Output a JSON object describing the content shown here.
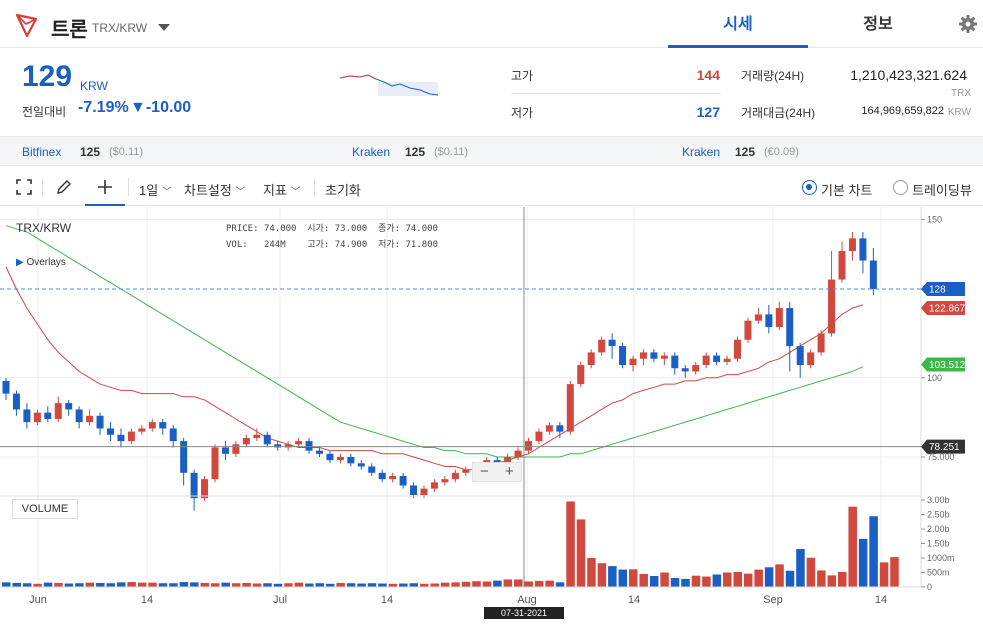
{
  "header": {
    "coin_name": "트론",
    "pair": "TRX/KRW",
    "tabs": [
      "시세",
      "정보"
    ]
  },
  "summary": {
    "price": "129",
    "unit": "KRW",
    "change_label": "전일대비",
    "change_pct": "-7.19%",
    "change_abs": "▼-10.00",
    "high_label": "고가",
    "high": "144",
    "low_label": "저가",
    "low": "127",
    "volume_label": "거래량(24H)",
    "volume": "1,210,423,321.624",
    "volume_unit": "TRX",
    "amount_label": "거래대금(24H)",
    "amount": "164,969,659,822",
    "amount_unit": "KRW"
  },
  "exchanges": [
    {
      "name": "Bitfinex",
      "price": "125",
      "ref": "($0.11)"
    },
    {
      "name": "Kraken",
      "price": "125",
      "ref": "($0.11)"
    },
    {
      "name": "Kraken",
      "price": "125",
      "ref": "(€0.09)"
    }
  ],
  "toolbar": {
    "interval": "1일",
    "chart_settings": "차트설정",
    "indicators": "지표",
    "reset": "초기화",
    "basic_chart": "기본 차트",
    "tradingview": "트레이딩뷰"
  },
  "colors": {
    "up": "#d1483f",
    "down": "#1a5fc4",
    "ma_short": "#d1483f",
    "ma_long": "#3db74a",
    "accent": "#1a5fc4"
  },
  "chart_data": {
    "type": "candlestick",
    "symbol": "TRX/KRW",
    "overlays_label": "Overlays",
    "ohlc_legend": {
      "price_label": "PRICE:",
      "price": "74.000",
      "open_label": "시가:",
      "open": "73.000",
      "close_label": "종가:",
      "close": "74.000",
      "vol_label": "VOL:",
      "vol": "244M",
      "high_label": "고가:",
      "high": "74.900",
      "low_label": "저가:",
      "low": "71.800"
    },
    "x_ticks": [
      "Jun",
      "14",
      "Jul",
      "14",
      "Aug",
      "14",
      "Sep",
      "14"
    ],
    "y_ticks": [
      "150",
      "100",
      "75.000"
    ],
    "vol_ticks": [
      "3.00b",
      "2.50b",
      "2.00b",
      "1.50b",
      "1000m",
      "500m",
      "0"
    ],
    "ylim": [
      63,
      152
    ],
    "vol_max": 3000,
    "price_badges": {
      "current": "128",
      "ma_short": "122.867",
      "ma_long": "103.512",
      "crosshair": "78.251"
    },
    "crosshair_date": "07-31-2021",
    "volume_label": "VOLUME",
    "ma_short_values": [
      135,
      128,
      122,
      117,
      112,
      108,
      105,
      102,
      100,
      98,
      97,
      96,
      96,
      95,
      95,
      95,
      95,
      94,
      94,
      93,
      91,
      89,
      87,
      85,
      83,
      81,
      80,
      79,
      78,
      78,
      78,
      77,
      77,
      77,
      77,
      77,
      76,
      76,
      76,
      75,
      74,
      73,
      72,
      72,
      71,
      71,
      72,
      73,
      74,
      75,
      76,
      78,
      80,
      82,
      84,
      86,
      88,
      90,
      92,
      93,
      95,
      96,
      97,
      98,
      98,
      99,
      99,
      100,
      100,
      101,
      101,
      102,
      103,
      105,
      106,
      108,
      110,
      112,
      114,
      117,
      120,
      122,
      123
    ],
    "ma_long_values": [
      148,
      147,
      146,
      144,
      142,
      140,
      138,
      136,
      134,
      132,
      130,
      128,
      126,
      124,
      122,
      120,
      118,
      116,
      114,
      112,
      110,
      108,
      106,
      104,
      102,
      100,
      98,
      96,
      94,
      92,
      90,
      88,
      86,
      85,
      84,
      83,
      82,
      81,
      80,
      79,
      78,
      78,
      77,
      77,
      76,
      76,
      76,
      75,
      75,
      75,
      75,
      75,
      75,
      75,
      76,
      76,
      77,
      78,
      79,
      80,
      81,
      82,
      83,
      84,
      85,
      86,
      87,
      88,
      89,
      90,
      91,
      92,
      93,
      94,
      95,
      96,
      97,
      98,
      99,
      100,
      101,
      102,
      103.5
    ],
    "candles": [
      [
        99,
        95,
        100,
        93
      ],
      [
        95,
        90,
        96,
        88
      ],
      [
        90,
        86,
        92,
        84
      ],
      [
        86,
        89,
        90,
        85
      ],
      [
        89,
        87,
        91,
        86
      ],
      [
        87,
        92,
        94,
        86
      ],
      [
        92,
        90,
        93,
        88
      ],
      [
        90,
        86,
        91,
        84
      ],
      [
        86,
        88,
        90,
        85
      ],
      [
        88,
        84,
        89,
        82
      ],
      [
        84,
        82,
        86,
        80
      ],
      [
        82,
        80,
        84,
        78
      ],
      [
        80,
        83,
        84,
        79
      ],
      [
        83,
        84,
        85,
        82
      ],
      [
        84,
        86,
        87,
        83
      ],
      [
        86,
        84,
        87,
        82
      ],
      [
        84,
        80,
        85,
        78
      ],
      [
        80,
        70,
        81,
        66
      ],
      [
        70,
        62,
        71,
        58
      ],
      [
        62,
        68,
        69,
        61
      ],
      [
        68,
        78,
        79,
        67
      ],
      [
        78,
        76,
        80,
        74
      ],
      [
        76,
        79,
        80,
        75
      ],
      [
        79,
        81,
        82,
        78
      ],
      [
        81,
        82,
        84,
        80
      ],
      [
        82,
        79,
        83,
        78
      ],
      [
        79,
        78,
        80,
        77
      ],
      [
        78,
        79,
        80,
        77
      ],
      [
        79,
        80,
        81,
        78
      ],
      [
        80,
        77,
        81,
        76
      ],
      [
        77,
        76,
        78,
        75
      ],
      [
        76,
        74,
        77,
        73
      ],
      [
        74,
        75,
        76,
        73
      ],
      [
        75,
        73,
        76,
        72
      ],
      [
        73,
        72,
        74,
        71
      ],
      [
        72,
        70,
        73,
        69
      ],
      [
        70,
        68,
        71,
        67
      ],
      [
        68,
        69,
        70,
        67
      ],
      [
        69,
        66,
        70,
        65
      ],
      [
        66,
        63,
        67,
        62
      ],
      [
        63,
        65,
        66,
        62
      ],
      [
        65,
        67,
        68,
        64
      ],
      [
        67,
        68,
        69,
        66
      ],
      [
        68,
        70,
        71,
        67
      ],
      [
        70,
        71,
        72,
        69
      ],
      [
        71,
        72,
        73,
        70
      ],
      [
        72,
        74,
        75,
        71
      ],
      [
        74,
        73,
        75,
        72
      ],
      [
        73,
        75,
        76,
        72
      ],
      [
        75,
        77,
        78,
        74
      ],
      [
        77,
        80,
        81,
        76
      ],
      [
        80,
        83,
        84,
        79
      ],
      [
        83,
        85,
        86,
        82
      ],
      [
        85,
        83,
        86,
        81
      ],
      [
        83,
        98,
        99,
        82
      ],
      [
        98,
        104,
        105,
        97
      ],
      [
        104,
        108,
        109,
        103
      ],
      [
        108,
        112,
        113,
        107
      ],
      [
        112,
        110,
        114,
        106
      ],
      [
        110,
        104,
        111,
        103
      ],
      [
        104,
        106,
        107,
        102
      ],
      [
        106,
        108,
        109,
        104
      ],
      [
        108,
        106,
        109,
        105
      ],
      [
        106,
        107,
        108,
        104
      ],
      [
        107,
        103,
        108,
        101
      ],
      [
        103,
        102,
        104,
        100
      ],
      [
        102,
        104,
        105,
        101
      ],
      [
        104,
        107,
        108,
        103
      ],
      [
        107,
        105,
        108,
        104
      ],
      [
        105,
        106,
        107,
        104
      ],
      [
        106,
        112,
        113,
        105
      ],
      [
        112,
        118,
        119,
        111
      ],
      [
        118,
        120,
        122,
        117
      ],
      [
        120,
        116,
        123,
        114
      ],
      [
        116,
        122,
        124,
        115
      ],
      [
        122,
        110,
        124,
        102
      ],
      [
        110,
        104,
        111,
        100
      ],
      [
        104,
        108,
        109,
        103
      ],
      [
        108,
        114,
        115,
        107
      ],
      [
        114,
        131,
        140,
        113
      ],
      [
        131,
        140,
        143,
        130
      ],
      [
        140,
        144,
        146,
        137
      ],
      [
        144,
        137,
        146,
        133
      ],
      [
        137,
        128,
        141,
        126
      ]
    ],
    "volumes": [
      160,
      140,
      130,
      110,
      150,
      140,
      120,
      130,
      150,
      140,
      130,
      160,
      170,
      150,
      150,
      130,
      130,
      170,
      160,
      140,
      130,
      150,
      130,
      140,
      120,
      130,
      110,
      130,
      150,
      120,
      130,
      110,
      140,
      130,
      120,
      130,
      120,
      110,
      120,
      130,
      110,
      120,
      150,
      160,
      180,
      200,
      190,
      220,
      260,
      260,
      190,
      210,
      220,
      160,
      2950,
      2330,
      1000,
      820,
      720,
      600,
      610,
      450,
      380,
      500,
      310,
      280,
      390,
      360,
      430,
      500,
      520,
      460,
      600,
      680,
      780,
      560,
      1310,
      1010,
      570,
      400,
      520,
      2770,
      1660,
      2440,
      850,
      1030
    ]
  }
}
